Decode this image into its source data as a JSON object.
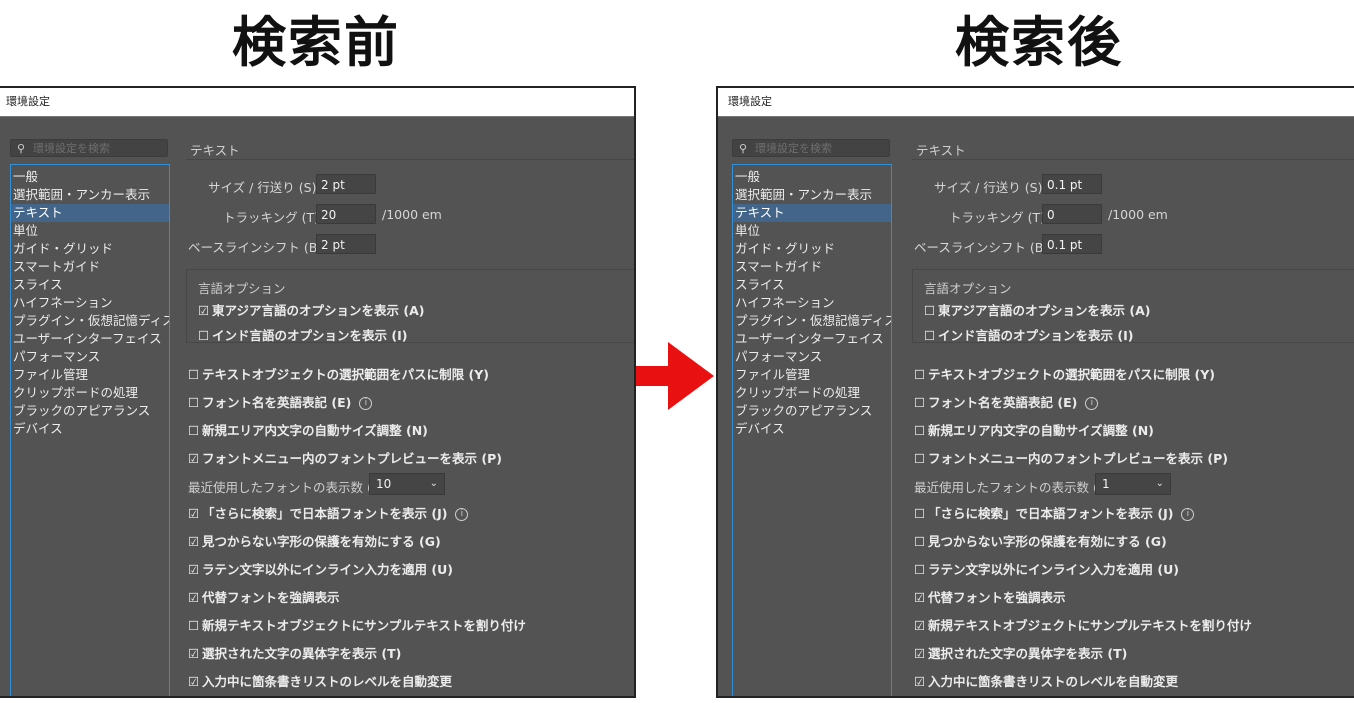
{
  "before": {
    "heading": "検索前",
    "title": "環境設定",
    "search_placeholder": "環境設定を検索",
    "sidebar": [
      "一般",
      "選択範囲・アンカー表示",
      "テキスト",
      "単位",
      "ガイド・グリッド",
      "スマートガイド",
      "スライス",
      "ハイフネーション",
      "プラグイン・仮想記憶ディスク",
      "ユーザーインターフェイス",
      "パフォーマンス",
      "ファイル管理",
      "クリップボードの処理",
      "ブラックのアピアランス",
      "デバイス"
    ],
    "section_title": "テキスト",
    "size_label": "サイズ / 行送り (S)：",
    "size_value": "2 pt",
    "tracking_label": "トラッキング (T)：",
    "tracking_value": "20",
    "tracking_unit": "/1000 em",
    "baseline_label": "ベースラインシフト (B)：",
    "baseline_value": "2 pt",
    "lang_options_title": "言語オプション",
    "east_asian": "東アジア言語のオプションを表示 (A)",
    "east_asian_checked": true,
    "indic": "インド言語のオプションを表示 (I)",
    "indic_checked": false,
    "recent_fonts_label": "最近使用したフォントの表示数 (F)：",
    "recent_fonts_value": "10",
    "options": [
      {
        "label": "テキストオブジェクトの選択範囲をパスに制限 (Y)",
        "checked": false
      },
      {
        "label": "フォント名を英語表記 (E)",
        "checked": false,
        "info": true
      },
      {
        "label": "新規エリア内文字の自動サイズ調整 (N)",
        "checked": false
      },
      {
        "label": "フォントメニュー内のフォントプレビューを表示 (P)",
        "checked": true
      }
    ],
    "options2": [
      {
        "label": "「さらに検索」で日本語フォントを表示 (J)",
        "checked": true,
        "info": true
      },
      {
        "label": "見つからない字形の保護を有効にする (G)",
        "checked": true
      },
      {
        "label": "ラテン文字以外にインライン入力を適用 (U)",
        "checked": true
      },
      {
        "label": "代替フォントを強調表示",
        "checked": true
      },
      {
        "label": "新規テキストオブジェクトにサンプルテキストを割り付け",
        "checked": false
      },
      {
        "label": "選択された文字の異体字を表示 (T)",
        "checked": true
      },
      {
        "label": "入力中に箇条書きリストのレベルを自動変更",
        "checked": true
      }
    ]
  },
  "after": {
    "heading": "検索後",
    "title": "環境設定",
    "search_placeholder": "環境設定を検索",
    "sidebar": [
      "一般",
      "選択範囲・アンカー表示",
      "テキスト",
      "単位",
      "ガイド・グリッド",
      "スマートガイド",
      "スライス",
      "ハイフネーション",
      "プラグイン・仮想記憶ディスク",
      "ユーザーインターフェイス",
      "パフォーマンス",
      "ファイル管理",
      "クリップボードの処理",
      "ブラックのアピアランス",
      "デバイス"
    ],
    "section_title": "テキスト",
    "size_label": "サイズ / 行送り (S)：",
    "size_value": "0.1 pt",
    "tracking_label": "トラッキング (T)：",
    "tracking_value": "0",
    "tracking_unit": "/1000 em",
    "baseline_label": "ベースラインシフト (B)：",
    "baseline_value": "0.1 pt",
    "lang_options_title": "言語オプション",
    "east_asian": "東アジア言語のオプションを表示 (A)",
    "east_asian_checked": false,
    "indic": "インド言語のオプションを表示 (I)",
    "indic_checked": false,
    "recent_fonts_label": "最近使用したフォントの表示数 (F)：",
    "recent_fonts_value": "1",
    "options": [
      {
        "label": "テキストオブジェクトの選択範囲をパスに制限 (Y)",
        "checked": false
      },
      {
        "label": "フォント名を英語表記 (E)",
        "checked": false,
        "info": true
      },
      {
        "label": "新規エリア内文字の自動サイズ調整 (N)",
        "checked": false
      },
      {
        "label": "フォントメニュー内のフォントプレビューを表示 (P)",
        "checked": false
      }
    ],
    "options2": [
      {
        "label": "「さらに検索」で日本語フォントを表示 (J)",
        "checked": false,
        "info": true
      },
      {
        "label": "見つからない字形の保護を有効にする (G)",
        "checked": false
      },
      {
        "label": "ラテン文字以外にインライン入力を適用 (U)",
        "checked": false
      },
      {
        "label": "代替フォントを強調表示",
        "checked": true
      },
      {
        "label": "新規テキストオブジェクトにサンプルテキストを割り付け",
        "checked": true
      },
      {
        "label": "選択された文字の異体字を表示 (T)",
        "checked": true
      },
      {
        "label": "入力中に箇条書きリストのレベルを自動変更",
        "checked": true
      }
    ]
  },
  "colors": {
    "arrow": "#e81010",
    "selection": "#43658a",
    "sidebar_border": "#2f8fd8",
    "panel_bg": "#535353"
  },
  "icons": {
    "arrow": "right-arrow-icon",
    "search": "search-icon",
    "checked": "checkbox-checked-icon",
    "unchecked": "checkbox-unchecked-icon",
    "info": "info-icon",
    "dropdown": "chevron-down-icon"
  }
}
